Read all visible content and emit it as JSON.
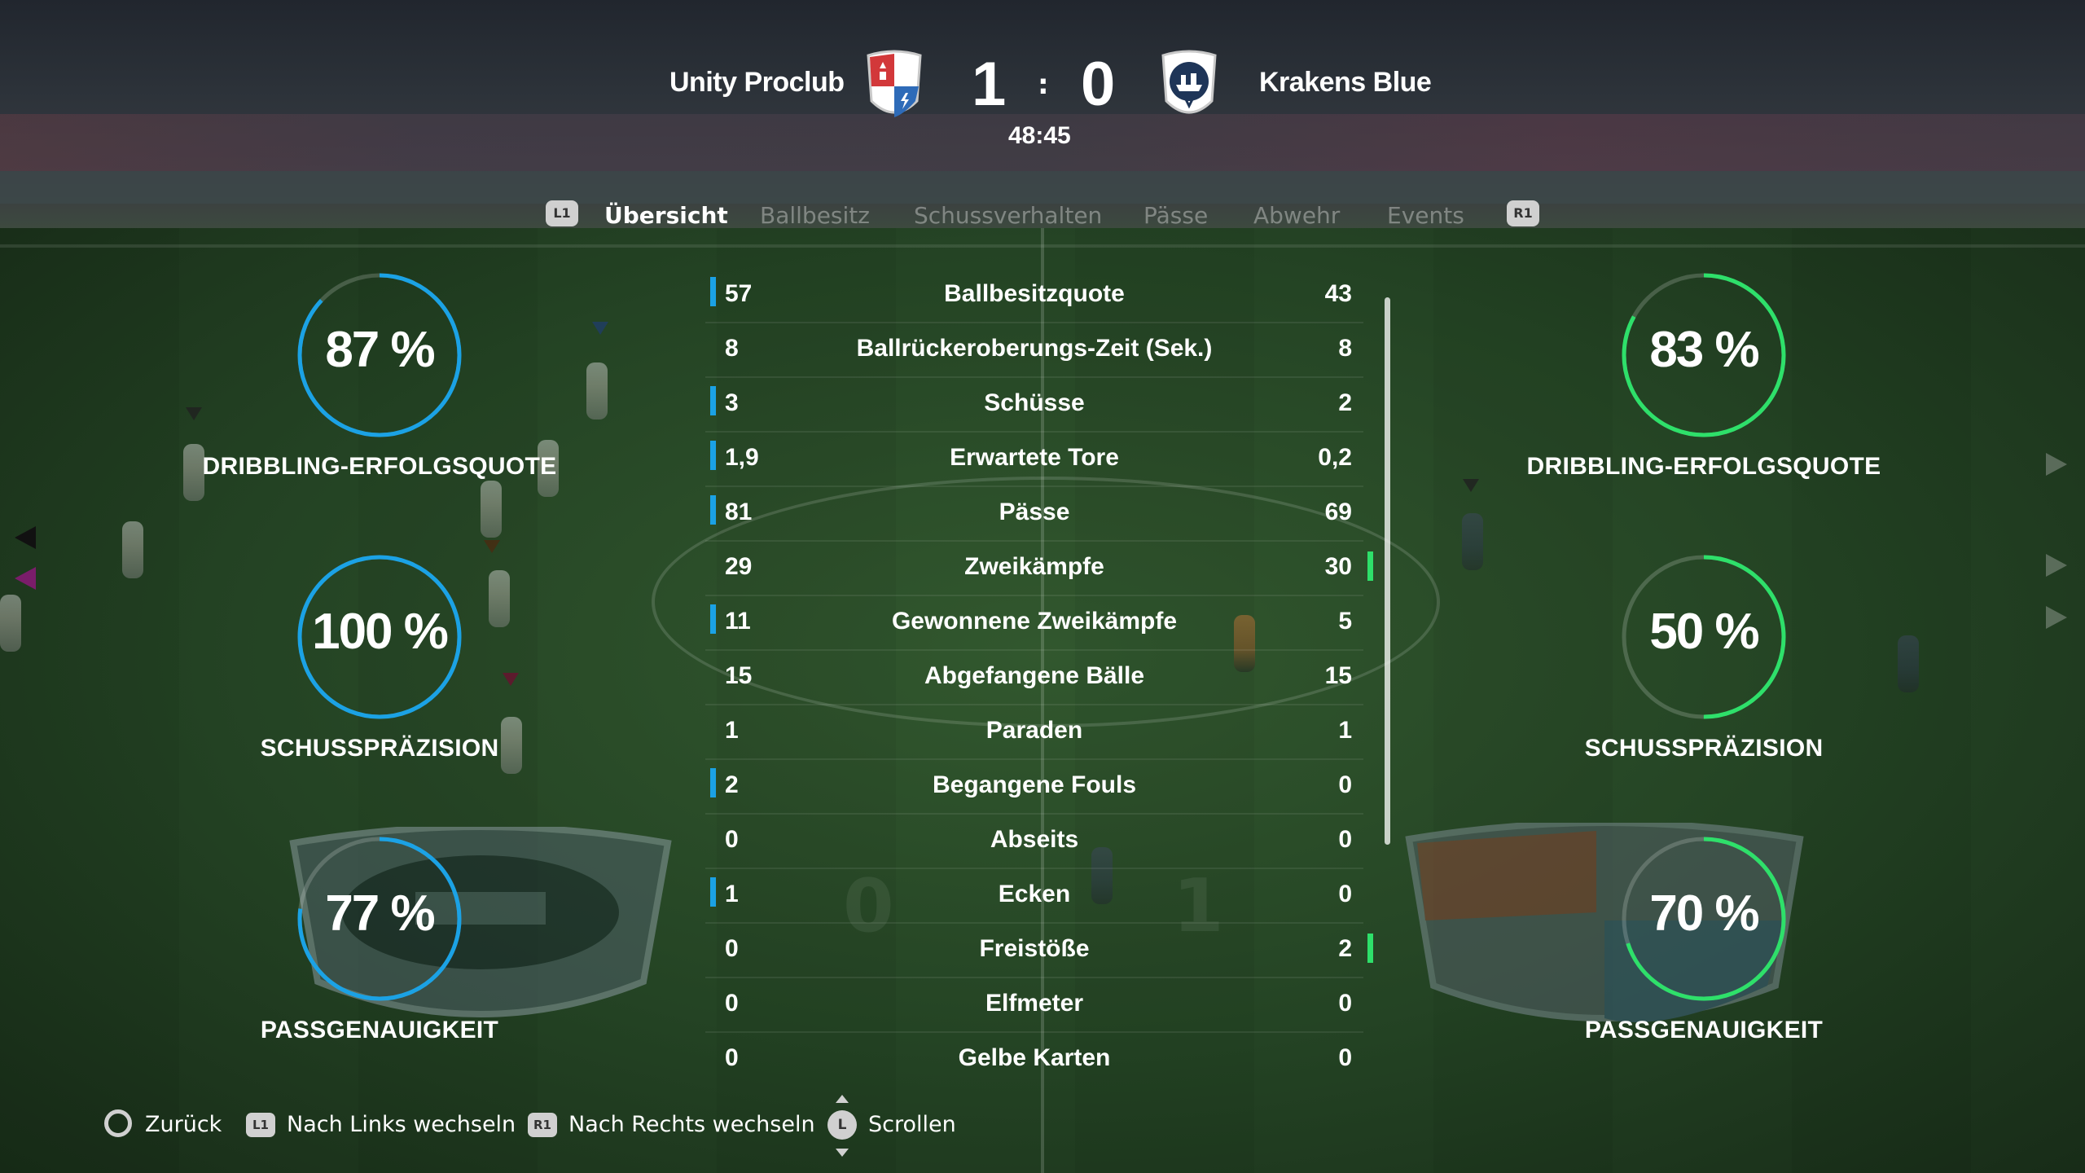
{
  "match": {
    "home_team": "Unity Proclub",
    "away_team": "Krakens Blue",
    "home_score": "1",
    "away_score": "0",
    "separator": ":",
    "clock": "48:45"
  },
  "tabs": {
    "left_button": "L1",
    "right_button": "R1",
    "items": [
      {
        "label": "Übersicht",
        "active": true
      },
      {
        "label": "Ballbesitz",
        "active": false
      },
      {
        "label": "Schussverhalten",
        "active": false
      },
      {
        "label": "Pässe",
        "active": false
      },
      {
        "label": "Abwehr",
        "active": false
      },
      {
        "label": "Events",
        "active": false
      }
    ]
  },
  "gauges": {
    "home": [
      {
        "value": 0.87,
        "text": "87 %",
        "label": "DRIBBLING-ERFOLGSQUOTE"
      },
      {
        "value": 1.0,
        "text": "100 %",
        "label": "SCHUSSPRÄZISION"
      },
      {
        "value": 0.77,
        "text": "77 %",
        "label": "PASSGENAUIGKEIT"
      }
    ],
    "away": [
      {
        "value": 0.83,
        "text": "83 %",
        "label": "DRIBBLING-ERFOLGSQUOTE"
      },
      {
        "value": 0.5,
        "text": "50 %",
        "label": "SCHUSSPRÄZISION"
      },
      {
        "value": 0.7,
        "text": "70 %",
        "label": "PASSGENAUIGKEIT"
      }
    ],
    "colors": {
      "home": "#1ba2e5",
      "away": "#2ee06a",
      "track": "rgba(255,255,255,0.18)"
    }
  },
  "stats": [
    {
      "name": "Ballbesitzquote",
      "home": "57",
      "away": "43",
      "lead": "home"
    },
    {
      "name": "Ballrückeroberungs-Zeit (Sek.)",
      "home": "8",
      "away": "8",
      "lead": "none"
    },
    {
      "name": "Schüsse",
      "home": "3",
      "away": "2",
      "lead": "home"
    },
    {
      "name": "Erwartete Tore",
      "home": "1,9",
      "away": "0,2",
      "lead": "home"
    },
    {
      "name": "Pässe",
      "home": "81",
      "away": "69",
      "lead": "home"
    },
    {
      "name": "Zweikämpfe",
      "home": "29",
      "away": "30",
      "lead": "away"
    },
    {
      "name": "Gewonnene Zweikämpfe",
      "home": "11",
      "away": "5",
      "lead": "home"
    },
    {
      "name": "Abgefangene Bälle",
      "home": "15",
      "away": "15",
      "lead": "none"
    },
    {
      "name": "Paraden",
      "home": "1",
      "away": "1",
      "lead": "none"
    },
    {
      "name": "Begangene Fouls",
      "home": "2",
      "away": "0",
      "lead": "home"
    },
    {
      "name": "Abseits",
      "home": "0",
      "away": "0",
      "lead": "none"
    },
    {
      "name": "Ecken",
      "home": "1",
      "away": "0",
      "lead": "home"
    },
    {
      "name": "Freistöße",
      "home": "0",
      "away": "2",
      "lead": "away"
    },
    {
      "name": "Elfmeter",
      "home": "0",
      "away": "0",
      "lead": "none"
    },
    {
      "name": "Gelbe Karten",
      "home": "0",
      "away": "0",
      "lead": "none"
    }
  ],
  "footer": {
    "back": "Zurück",
    "left_switch": "Nach Links wechseln",
    "left_button": "L1",
    "right_switch": "Nach Rechts wechseln",
    "right_button": "R1",
    "scroll": "Scrollen",
    "stick_button": "L"
  },
  "background": {
    "watermark_left": "0",
    "watermark_right": "1"
  }
}
